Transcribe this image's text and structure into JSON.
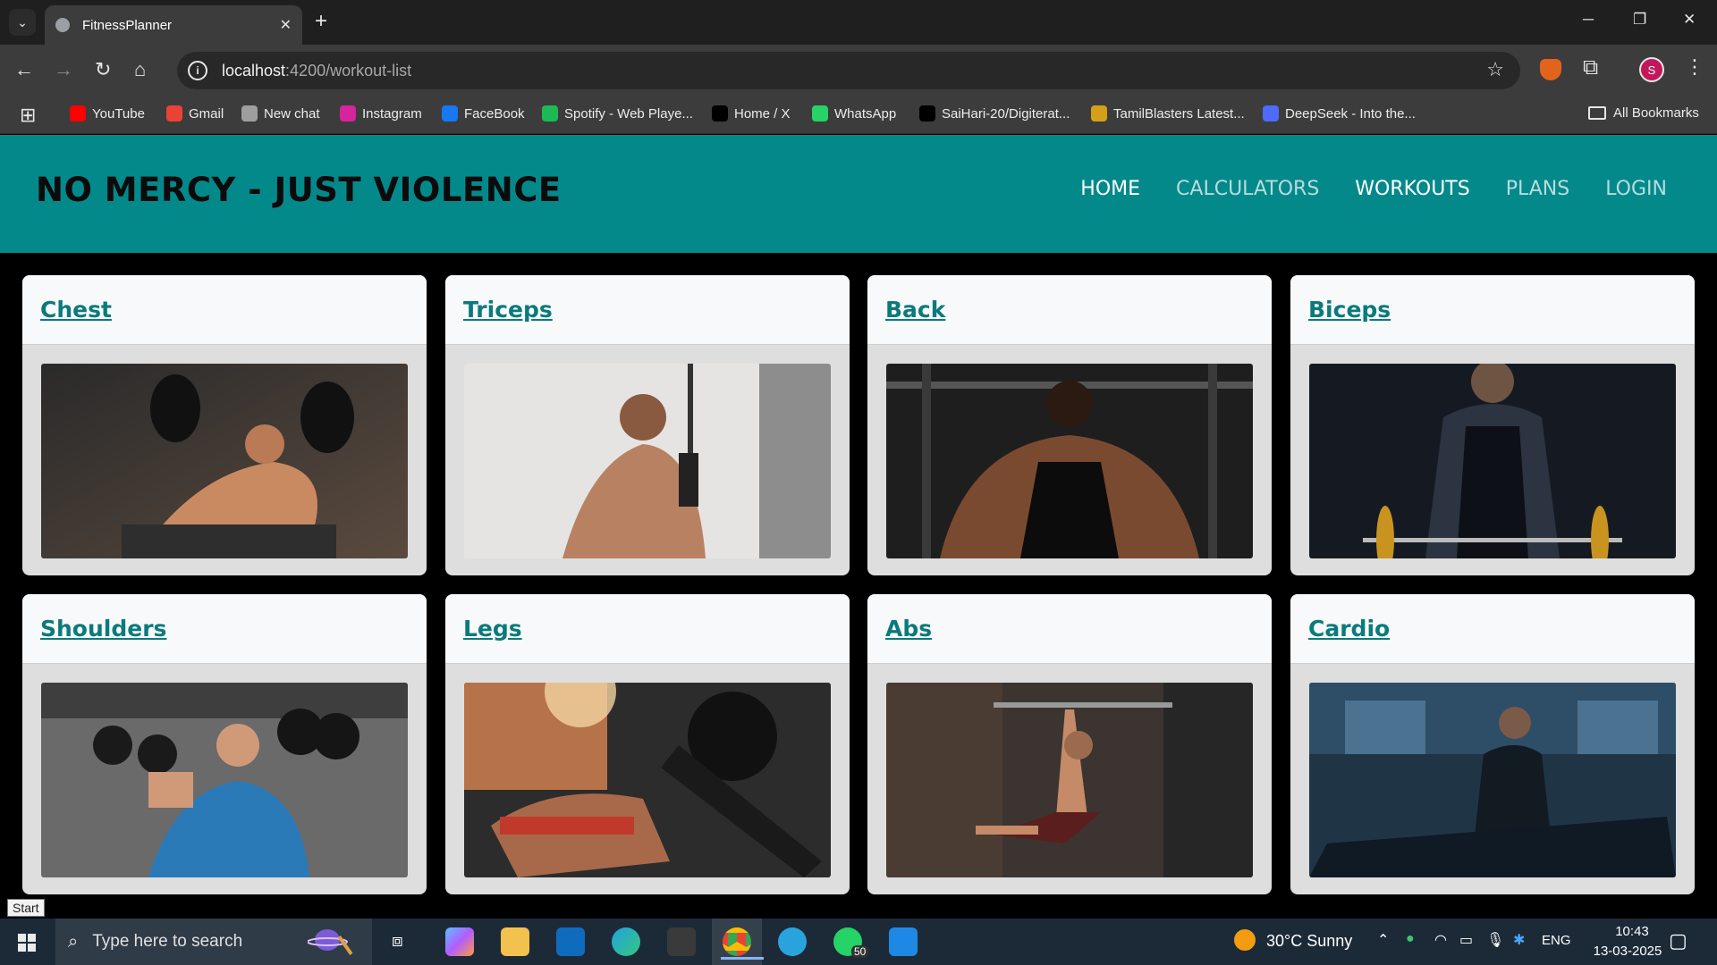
{
  "browser": {
    "tab_title": "FitnessPlanner",
    "url_host": "localhost",
    "url_path": ":4200/workout-list",
    "profile_initial": "S",
    "bookmarks": [
      {
        "label": "YouTube",
        "icon": "youtube-icon",
        "color": "#ff0000"
      },
      {
        "label": "Gmail",
        "icon": "gmail-icon",
        "color": "#ea4335"
      },
      {
        "label": "New chat",
        "icon": "chat-icon",
        "color": "#9e9e9e"
      },
      {
        "label": "Instagram",
        "icon": "instagram-icon",
        "color": "#d6249f"
      },
      {
        "label": "FaceBook",
        "icon": "facebook-icon",
        "color": "#1877f2"
      },
      {
        "label": "Spotify - Web Playe...",
        "icon": "spotify-icon",
        "color": "#1db954"
      },
      {
        "label": "Home / X",
        "icon": "x-icon",
        "color": "#000000"
      },
      {
        "label": "WhatsApp",
        "icon": "whatsapp-icon",
        "color": "#25d366"
      },
      {
        "label": "SaiHari-20/Digiterat...",
        "icon": "github-icon",
        "color": "#000000"
      },
      {
        "label": "TamilBlasters Latest...",
        "icon": "tamilblasters-icon",
        "color": "#d4a017"
      },
      {
        "label": "DeepSeek - Into the...",
        "icon": "deepseek-icon",
        "color": "#4d6bfe"
      }
    ],
    "all_bookmarks": "All Bookmarks"
  },
  "site": {
    "brand": "NO MERCY - JUST VIOLENCE",
    "nav": [
      "HOME",
      "CALCULATORS",
      "WORKOUTS",
      "PLANS",
      "LOGIN"
    ],
    "workouts": [
      {
        "title": "Chest",
        "image": "chest-press-photo"
      },
      {
        "title": "Triceps",
        "image": "triceps-pushdown-photo"
      },
      {
        "title": "Back",
        "image": "lat-pulldown-photo"
      },
      {
        "title": "Biceps",
        "image": "barbell-curl-photo"
      },
      {
        "title": "Shoulders",
        "image": "shoulder-press-photo"
      },
      {
        "title": "Legs",
        "image": "leg-press-photo"
      },
      {
        "title": "Abs",
        "image": "hanging-leg-raise-photo"
      },
      {
        "title": "Cardio",
        "image": "treadmill-photo"
      }
    ]
  },
  "tooltip": "Start",
  "taskbar": {
    "search_placeholder": "Type here to search",
    "weather": "30°C  Sunny",
    "language": "ENG",
    "time": "10:43",
    "date": "13-03-2025",
    "whatsapp_badge": "50"
  }
}
